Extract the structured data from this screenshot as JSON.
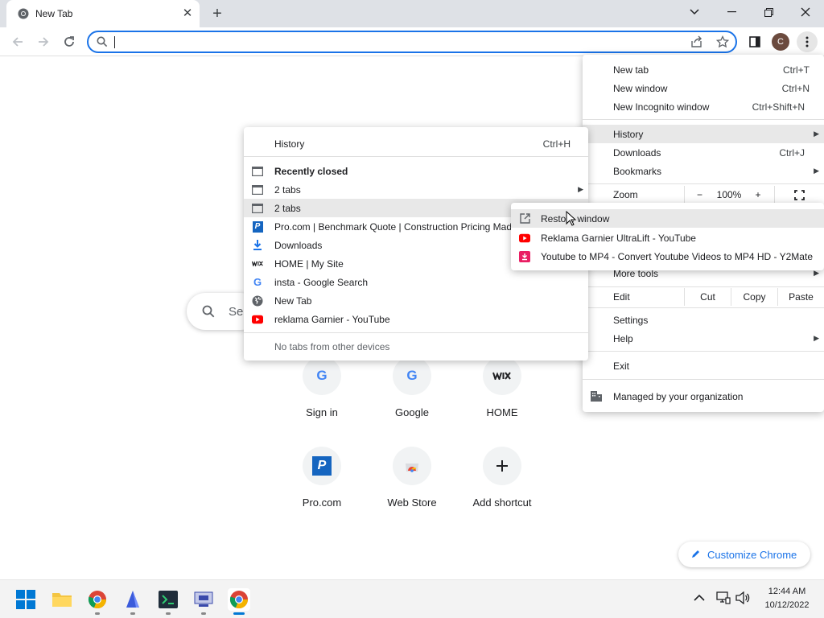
{
  "tab": {
    "title": "New Tab"
  },
  "toolbar": {
    "avatar_initial": "C"
  },
  "ntp": {
    "search_placeholder": "Se",
    "shortcuts": [
      {
        "label": "Sign in",
        "icon": "google-icon"
      },
      {
        "label": "Google",
        "icon": "google-icon"
      },
      {
        "label": "HOME",
        "icon": "wix-icon"
      },
      {
        "label": "Pro.com",
        "icon": "procom-icon"
      },
      {
        "label": "Web Store",
        "icon": "webstore-icon"
      },
      {
        "label": "Add shortcut",
        "icon": "plus-icon"
      }
    ],
    "customize_label": "Customize Chrome"
  },
  "chrome_menu": {
    "new_tab": {
      "label": "New tab",
      "shortcut": "Ctrl+T"
    },
    "new_window": {
      "label": "New window",
      "shortcut": "Ctrl+N"
    },
    "incognito": {
      "label": "New Incognito window",
      "shortcut": "Ctrl+Shift+N"
    },
    "history": "History",
    "downloads": {
      "label": "Downloads",
      "shortcut": "Ctrl+J"
    },
    "bookmarks": "Bookmarks",
    "zoom": {
      "label": "Zoom",
      "minus": "−",
      "value": "100%",
      "plus": "+"
    },
    "more_tools": "More tools",
    "edit": {
      "label": "Edit",
      "cut": "Cut",
      "copy": "Copy",
      "paste": "Paste"
    },
    "settings": "Settings",
    "help": "Help",
    "exit": "Exit",
    "managed": "Managed by your organization"
  },
  "history_menu": {
    "history": {
      "label": "History",
      "shortcut": "Ctrl+H"
    },
    "recently_closed": "Recently closed",
    "items": [
      {
        "label": "2 tabs",
        "icon": "window-icon",
        "arrow": true
      },
      {
        "label": "2 tabs",
        "icon": "window-icon",
        "arrow": false
      },
      {
        "label": "Pro.com | Benchmark Quote | Construction Pricing Made",
        "icon": "procom-icon"
      },
      {
        "label": "Downloads",
        "icon": "download-icon"
      },
      {
        "label": "HOME | My Site",
        "icon": "wix-icon"
      },
      {
        "label": "insta - Google Search",
        "icon": "google-icon"
      },
      {
        "label": "New Tab",
        "icon": "globe-icon"
      },
      {
        "label": "reklama Garnier - YouTube",
        "icon": "youtube-icon"
      }
    ],
    "no_tabs": "No tabs from other devices"
  },
  "submenu": {
    "restore": "Restore window",
    "items": [
      {
        "label": "Reklama Garnier UltraLift - YouTube",
        "icon": "youtube-icon"
      },
      {
        "label": "Youtube to MP4 - Convert Youtube Videos to MP4 HD - Y2Mate",
        "icon": "y2mate-icon"
      }
    ]
  },
  "taskbar": {
    "time": "12:44 AM",
    "date": "10/12/2022"
  },
  "colors": {
    "accent": "#1a73e8",
    "youtube": "#ff0000",
    "y2mate": "#e91e63"
  }
}
